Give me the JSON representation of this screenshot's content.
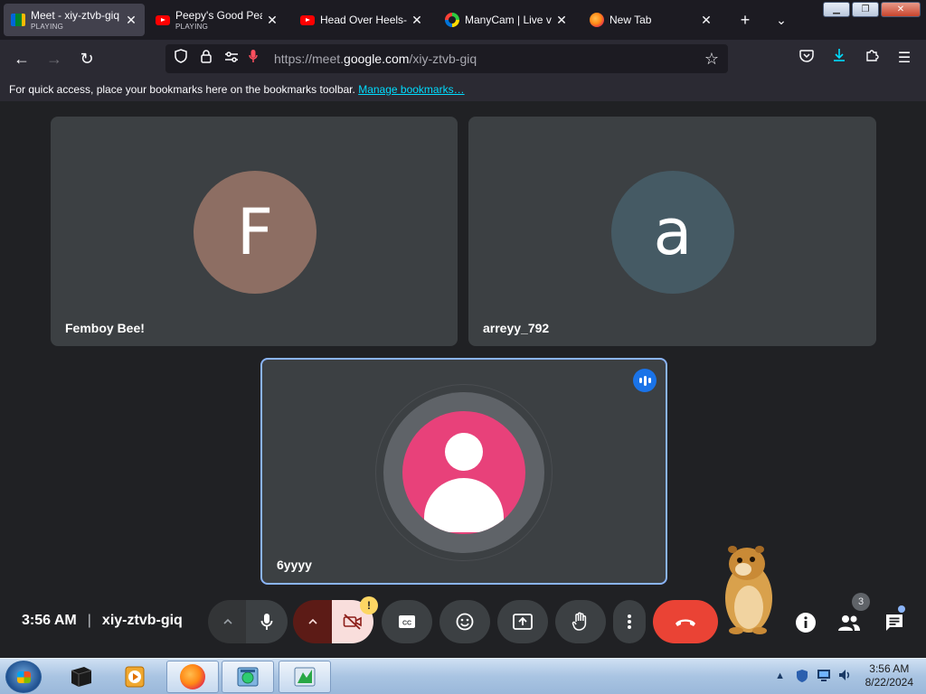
{
  "browser": {
    "tabs": [
      {
        "title": "Meet - xiy-ztvb-giq",
        "subtitle": "PLAYING",
        "icon": "google-meet-icon"
      },
      {
        "title": "Peepy's Good Peanut",
        "subtitle": "PLAYING",
        "icon": "youtube-icon"
      },
      {
        "title": "Head Over Heels- T",
        "subtitle": "",
        "icon": "youtube-icon"
      },
      {
        "title": "ManyCam | Live vid",
        "subtitle": "",
        "icon": "manycam-icon"
      },
      {
        "title": "New Tab",
        "subtitle": "",
        "icon": "firefox-icon"
      }
    ],
    "url": {
      "scheme_prefix": "https://meet.",
      "host": "google.com",
      "path": "/xiy-ztvb-giq"
    },
    "bookmarks_bar": {
      "message": "For quick access, place your bookmarks here on the bookmarks toolbar.",
      "link": "Manage bookmarks…"
    }
  },
  "meet": {
    "participants": [
      {
        "name": "Femboy Bee!",
        "initial": "F",
        "avatar_color": "#8d6e63"
      },
      {
        "name": "arreyy_792",
        "initial": "a",
        "avatar_color": "#455a64"
      },
      {
        "name": "6yyyy",
        "initial": "",
        "avatar_color": "#e8417a",
        "speaking": true
      }
    ],
    "time": "3:56 AM",
    "meeting_code": "xiy-ztvb-giq",
    "camera_warning": "!",
    "people_count": "3",
    "colors": {
      "accent": "#8ab4f8",
      "end_call": "#ea4335",
      "tile": "#3c4043",
      "background": "#202124"
    }
  },
  "taskbar": {
    "time": "3:56 AM",
    "date": "8/22/2024"
  }
}
